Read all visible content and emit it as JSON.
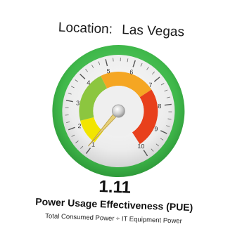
{
  "location": {
    "label": "Location:",
    "name": "Las Vegas"
  },
  "gauge": {
    "min": 1,
    "max": 10,
    "tick_labels": [
      "1",
      "2",
      "3",
      "4",
      "5",
      "6",
      "7",
      "8",
      "9",
      "10"
    ],
    "value": 1.11,
    "colors": {
      "rim": "#3fb84a",
      "dial_face": "#ececec",
      "band_low": "#f2e500",
      "band_mid": "#f5a623",
      "band_high": "#e8401c",
      "band_good": "#8cc63f",
      "needle": "#e6cf78"
    }
  },
  "reading": {
    "value_text": "1.11",
    "title": "Power Usage Effectiveness (PUE)",
    "formula": "Total Consumed Power ÷ IT Equipment Power"
  }
}
